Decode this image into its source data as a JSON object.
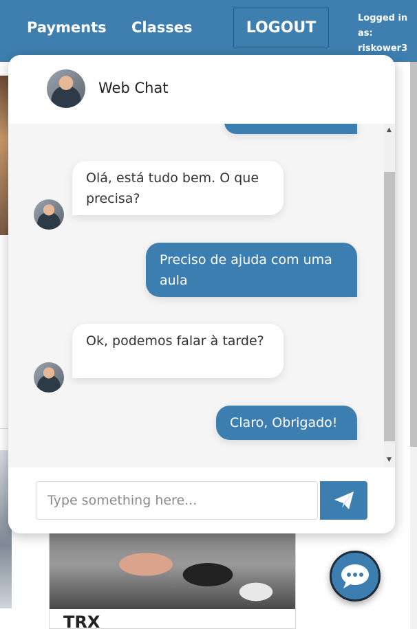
{
  "nav": {
    "payments": "Payments",
    "classes": "Classes",
    "logout": "LOGOUT",
    "logged_in_line1": "Logged in",
    "logged_in_line2": "as:",
    "username": "riskower3"
  },
  "chat": {
    "title": "Web Chat",
    "messages": [
      {
        "from": "agent",
        "text": "Olá, está tudo bem. O que precisa?"
      },
      {
        "from": "user",
        "text": "Preciso de ajuda com uma aula"
      },
      {
        "from": "agent",
        "text": "Ok, podemos falar à tarde?"
      },
      {
        "from": "user",
        "text": "Claro, Obrigado!"
      }
    ],
    "input_placeholder": "Type something here...",
    "send_icon": "paper-plane-icon"
  },
  "background": {
    "card_title": "TRX"
  },
  "launcher_icon": "chat-bubble-icon",
  "colors": {
    "nav": "#3e7fb0",
    "accent": "#3d7eb0",
    "chat_bg": "#f5f5f5"
  }
}
